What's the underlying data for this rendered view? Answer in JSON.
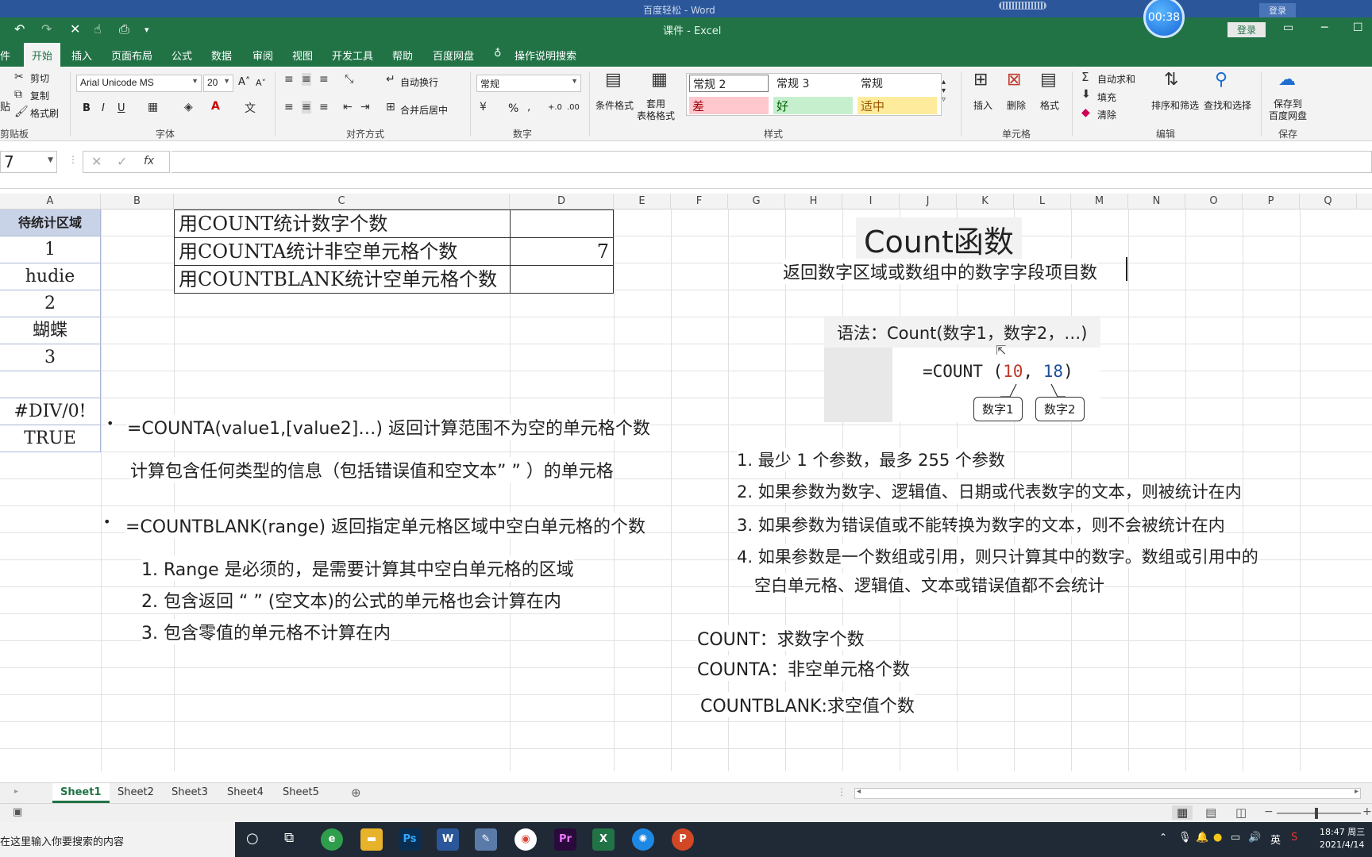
{
  "word_strip": {
    "title": "百度轻松 - Word",
    "login": "登录"
  },
  "timer": "00:38",
  "window": {
    "title": "课件  -  Excel",
    "login": "登录"
  },
  "tabs": [
    "件",
    "开始",
    "插入",
    "页面布局",
    "公式",
    "数据",
    "审阅",
    "视图",
    "开发工具",
    "帮助",
    "百度网盘",
    "操作说明搜索"
  ],
  "ribbon": {
    "clipboard": {
      "cut": "剪切",
      "copy": "复制",
      "format_painter": "格式刷",
      "paste": "贴",
      "label": "剪贴板"
    },
    "font": {
      "name": "Arial Unicode MS",
      "size": "20",
      "label": "字体",
      "bold": "B",
      "italic": "I",
      "underline": "U"
    },
    "align": {
      "wrap": "自动换行",
      "merge": "合并后居中",
      "label": "对齐方式"
    },
    "number": {
      "format": "常规",
      "percent": "%",
      "label": "数字"
    },
    "styles": {
      "cond_format": "条件格式",
      "table_format": "套用\n表格格式",
      "s1": "常规 2",
      "s2": "常规 3",
      "s3": "常规",
      "bad": "差",
      "good": "好",
      "neutral": "适中",
      "label": "样式"
    },
    "cells": {
      "insert": "插入",
      "delete": "删除",
      "format": "格式",
      "label": "单元格"
    },
    "editing": {
      "autosum": "自动求和",
      "fill": "填充",
      "clear": "清除",
      "sort": "排序和筛选",
      "find": "查找和选择",
      "label": "编辑"
    },
    "save": {
      "btn": "保存到\n百度网盘",
      "label": "保存"
    }
  },
  "formula_bar": {
    "name_box": "7",
    "fx": "fx",
    "value": ""
  },
  "columns": [
    "A",
    "B",
    "C",
    "D",
    "E",
    "F",
    "G",
    "H",
    "I",
    "J",
    "K",
    "L",
    "M",
    "N",
    "O",
    "P",
    "Q"
  ],
  "col_a": {
    "header": "待统计区域",
    "values": [
      "1",
      "hudie",
      "2",
      "蝴蝶",
      "3",
      "",
      "#DIV/0!",
      "TRUE"
    ]
  },
  "table": {
    "rows": [
      {
        "label": "用COUNT统计数字个数",
        "value": ""
      },
      {
        "label": "用COUNTA统计非空单元格个数",
        "value": "7"
      },
      {
        "label": "用COUNTBLANK统计空单元格个数",
        "value": ""
      }
    ]
  },
  "left_notes": {
    "counta": "=COUNTA(value1,[value2]…)   返回计算范围不为空的单元格个数",
    "counta_desc": "计算包含任何类型的信息（包括错误值和空文本”  ”  ）的单元格",
    "countblank": "=COUNTBLANK(range)   返回指定单元格区域中空白单元格的个数",
    "cb1": "1. Range 是必须的，是需要计算其中空白单元格的区域",
    "cb2": "2. 包含返回  “ ”  (空文本)的公式的单元格也会计算在内",
    "cb3": "3. 包含零值的单元格不计算在内"
  },
  "right_notes": {
    "title": "Count函数",
    "subtitle": "返回数字区域或数组中的数字字段项目数",
    "syntax": "语法：Count(数字1，数字2，…)",
    "formula_prefix": "=COUNT (",
    "formula_a": "10",
    "formula_sep": ",",
    "formula_b": "18",
    "formula_suffix": ")",
    "callout1": "数字1",
    "callout2": "数字2",
    "r1": "1. 最少 1 个参数，最多 255 个参数",
    "r2": "2. 如果参数为数字、逻辑值、日期或代表数字的文本，则被统计在内",
    "r3": "3. 如果参数为错误值或不能转换为数字的文本，则不会被统计在内",
    "r4a": "4. 如果参数是一个数组或引用，则只计算其中的数字。数组或引用中的",
    "r4b": "空白单元格、逻辑值、文本或错误值都不会统计",
    "s1": "COUNT：求数字个数",
    "s2": "COUNTA：非空单元格个数",
    "s3": "COUNTBLANK:求空值个数"
  },
  "sheet_tabs": [
    "Sheet1",
    "Sheet2",
    "Sheet3",
    "Sheet4",
    "Sheet5"
  ],
  "taskbar": {
    "search": "在这里输入你要搜索的内容",
    "time": "18:47 周三",
    "date": "2021/4/14",
    "lang": "英"
  },
  "colors": {
    "excel_green": "#217346",
    "red_num": "#c0392b",
    "blue_num": "#1f4e9c",
    "bad_bg": "#ffc7ce",
    "good_bg": "#c6efce",
    "neutral_bg": "#ffeb9c"
  }
}
